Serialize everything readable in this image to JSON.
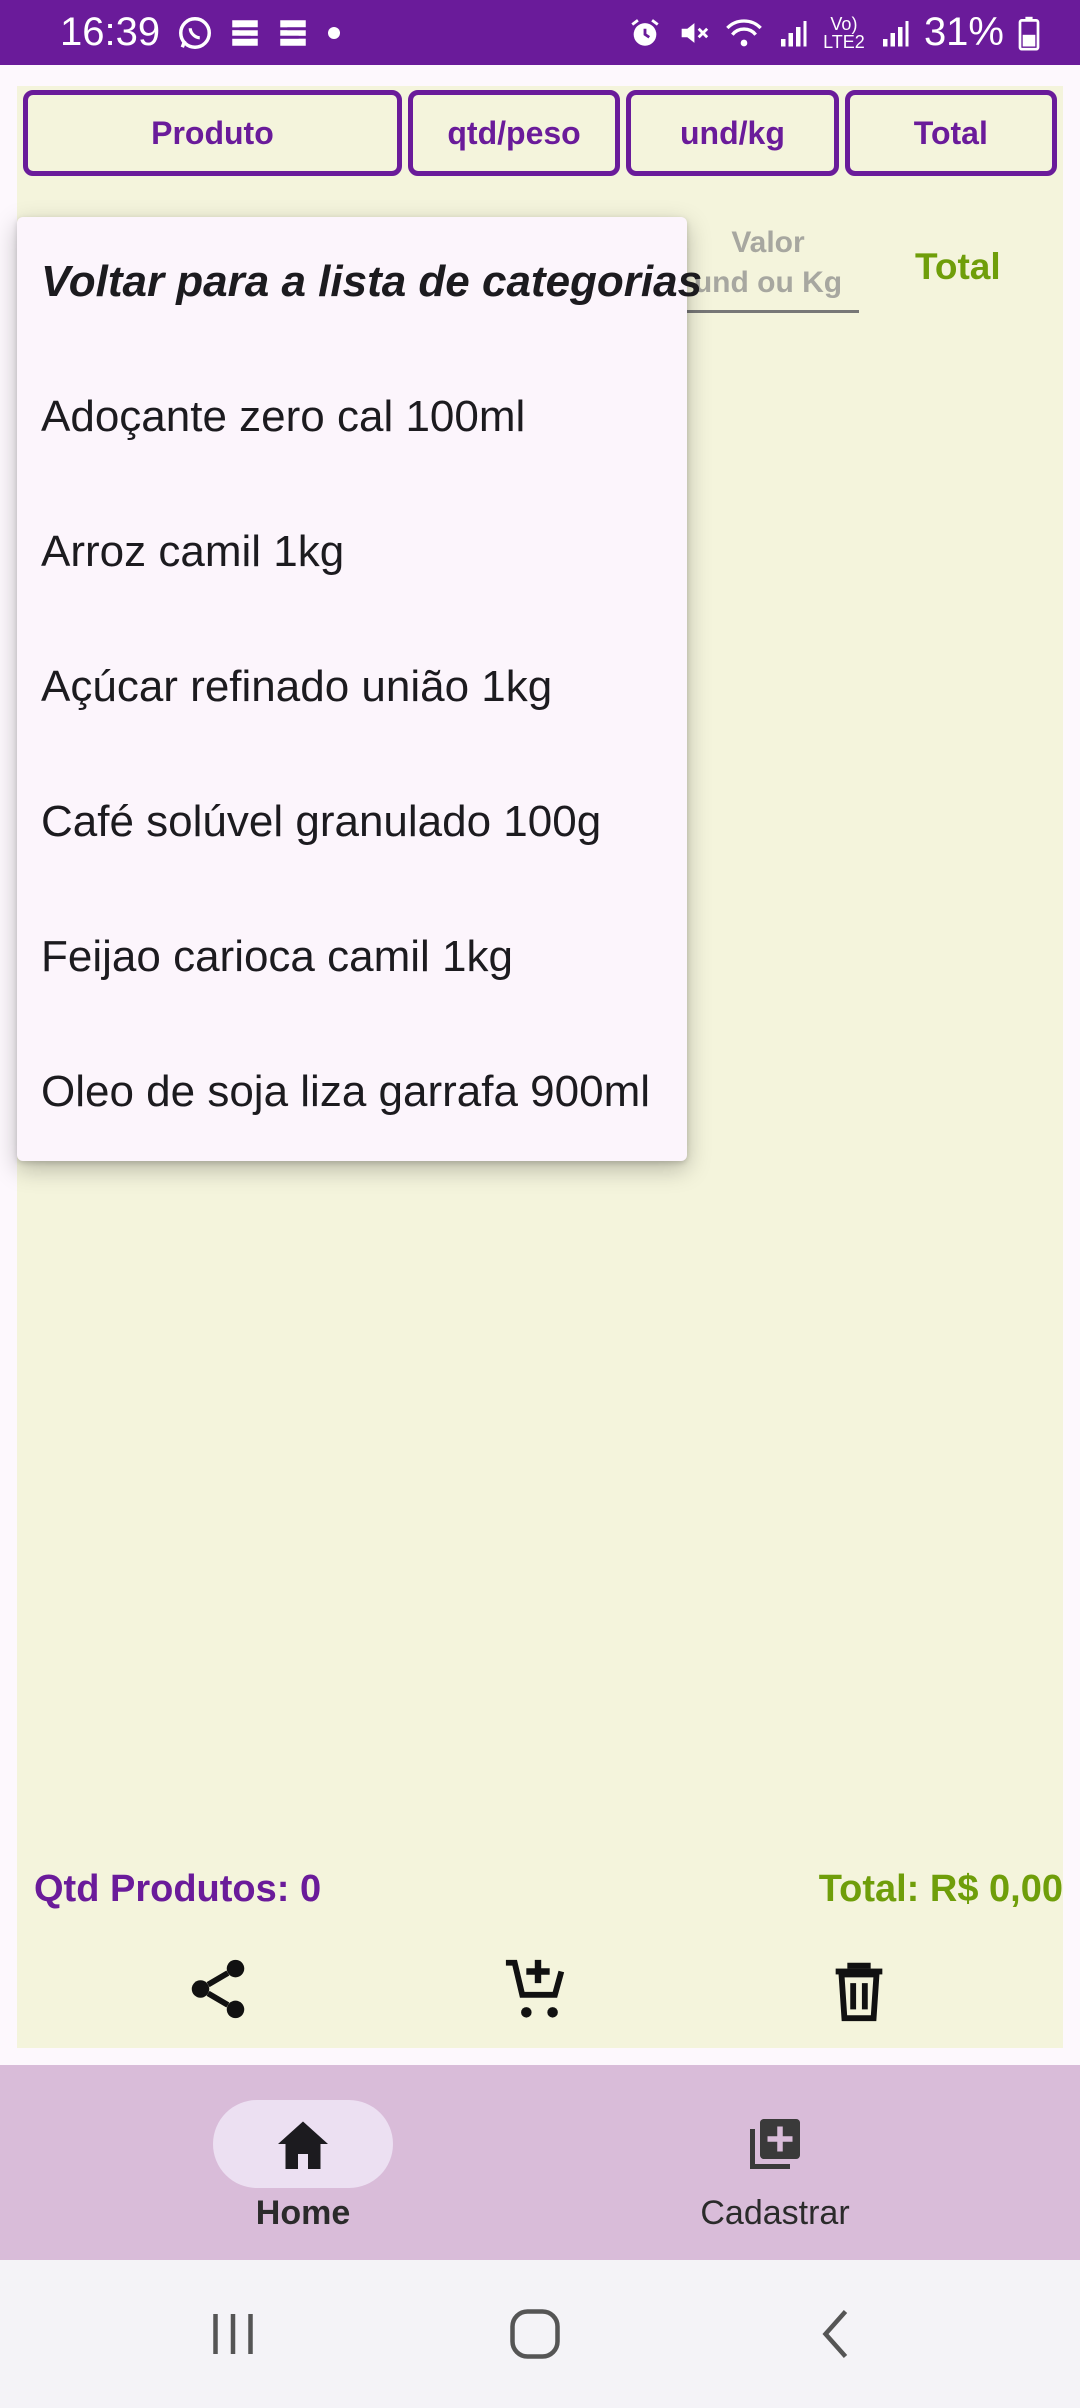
{
  "status_bar": {
    "time": "16:39",
    "battery": "31%",
    "network_label": "Vo) LTE2",
    "icons": [
      "whatsapp-icon",
      "app-s-icon",
      "app-s-icon",
      "dot-icon",
      "alarm-icon",
      "mute-icon",
      "wifi-icon",
      "signal-icon",
      "signal-icon",
      "battery-icon"
    ]
  },
  "header": {
    "produto": "Produto",
    "qtd_peso": "qtd/peso",
    "und_kg": "und/kg",
    "total": "Total"
  },
  "input": {
    "valor_line1": "Valor",
    "valor_line2": "und ou Kg",
    "total_label": "Total"
  },
  "menu": {
    "back_label": "Voltar para a lista de categorias",
    "items": [
      {
        "label": "Adoçante zero cal 100ml"
      },
      {
        "label": "Arroz camil 1kg"
      },
      {
        "label": "Açúcar refinado união 1kg"
      },
      {
        "label": "Café solúvel granulado 100g"
      },
      {
        "label": "Feijao carioca camil 1kg"
      },
      {
        "label": "Oleo de soja liza garrafa 900ml"
      }
    ]
  },
  "summary": {
    "qtd_produtos": "Qtd Produtos: 0",
    "total": "Total: R$ 0,00"
  },
  "bottom_nav": {
    "home": "Home",
    "cadastrar": "Cadastrar"
  },
  "colors": {
    "primary": "#6a1b9a",
    "accent_green": "#6f9e0a",
    "surface": "#f4f4dc",
    "nav_bg": "#d9bcd9"
  }
}
